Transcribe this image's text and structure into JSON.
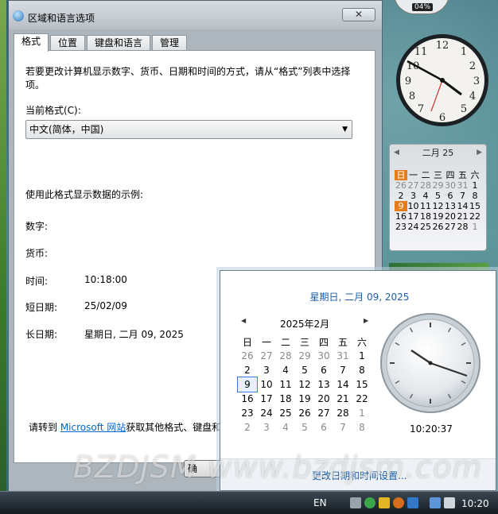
{
  "gadgets": {
    "cpu": {
      "percent": "04%"
    },
    "calendar": {
      "month_label": "二月 25",
      "weekdays": [
        "日",
        "一",
        "二",
        "三",
        "四",
        "五",
        "六"
      ],
      "weeks": [
        [
          "26",
          "27",
          "28",
          "29",
          "30",
          "31",
          "1"
        ],
        [
          "2",
          "3",
          "4",
          "5",
          "6",
          "7",
          "8"
        ],
        [
          "9",
          "10",
          "11",
          "12",
          "13",
          "14",
          "15"
        ],
        [
          "16",
          "17",
          "18",
          "19",
          "20",
          "21",
          "22"
        ],
        [
          "23",
          "24",
          "25",
          "26",
          "27",
          "28",
          "1"
        ]
      ]
    }
  },
  "dialog": {
    "title": "区域和语言选项",
    "close_symbol": "✕",
    "tabs": [
      "格式",
      "位置",
      "键盘和语言",
      "管理"
    ],
    "description": "若要更改计算机显示数字、货币、日期和时间的方式，请从“格式”列表中选择项。",
    "current_format_label": "当前格式(C):",
    "current_format_value": "中文(简体，中国)",
    "samples_title": "使用此格式显示数据的示例:",
    "samples": [
      {
        "label": "数字:",
        "value": ""
      },
      {
        "label": "货币:",
        "value": ""
      },
      {
        "label": "时间:",
        "value": "10:18:00"
      },
      {
        "label": "短日期:",
        "value": "25/02/09"
      },
      {
        "label": "长日期:",
        "value": "星期日, 二月 09, 2025"
      }
    ],
    "link_prefix": "请转到 ",
    "link_text": "Microsoft 网站",
    "link_suffix": "获取其他格式、键盘和",
    "bottom_button_partial": "确"
  },
  "clock_popup": {
    "long_date": "星期日, 二月 09, 2025",
    "month_title": "2025年2月",
    "weekdays": [
      "日",
      "一",
      "二",
      "三",
      "四",
      "五",
      "六"
    ],
    "weeks": [
      [
        "26",
        "27",
        "28",
        "29",
        "30",
        "31",
        "1"
      ],
      [
        "2",
        "3",
        "4",
        "5",
        "6",
        "7",
        "8"
      ],
      [
        "9",
        "10",
        "11",
        "12",
        "13",
        "14",
        "15"
      ],
      [
        "16",
        "17",
        "18",
        "19",
        "20",
        "21",
        "22"
      ],
      [
        "23",
        "24",
        "25",
        "26",
        "27",
        "28",
        "1"
      ],
      [
        "2",
        "3",
        "4",
        "5",
        "6",
        "7",
        "8"
      ]
    ],
    "selected_day": "9",
    "time": "10:20:37",
    "footer_link": "更改日期和时间设置..."
  },
  "watermark": "BZDJSM www.bzdjsm.com",
  "taskbar": {
    "language": "EN",
    "clock": "10:20"
  }
}
